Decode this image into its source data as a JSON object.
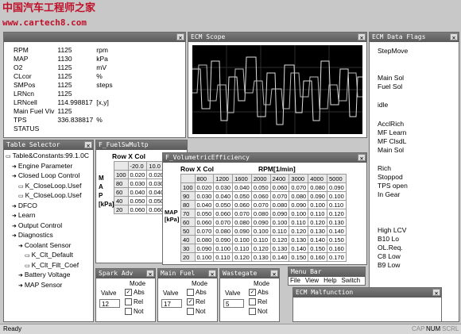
{
  "watermark": {
    "cn": "中国汽车工程师之家",
    "url": "www.cartech8.com"
  },
  "params": {
    "rows": [
      {
        "name": "RPM",
        "value": "1125",
        "unit": "rpm"
      },
      {
        "name": "MAP",
        "value": "1130",
        "unit": "kPa"
      },
      {
        "name": "O2",
        "value": "1125",
        "unit": "mV"
      },
      {
        "name": "CLcor",
        "value": "1125",
        "unit": "%"
      },
      {
        "name": "SMPos",
        "value": "1125",
        "unit": "steps"
      },
      {
        "name": "LRNcn",
        "value": "1125",
        "unit": ""
      },
      {
        "name": "LRNcell",
        "value": "114.998817",
        "unit": "[x,y]"
      },
      {
        "name": "Main Fuel Viv",
        "value": "1125",
        "unit": ""
      },
      {
        "name": "TPS",
        "value": "336.838817",
        "unit": "%"
      },
      {
        "name": "STATUS",
        "value": "",
        "unit": ""
      }
    ]
  },
  "scope": {
    "title": "ECM Scope"
  },
  "flags": {
    "title": "ECM Data Flags",
    "items": [
      "StepMove",
      "Main Sol",
      "Fuel Sol",
      "idle",
      "AcclRich",
      "MF Learn",
      "MF ClsdL",
      "Main Sol",
      "Rich",
      "Stoppod",
      "TPS open",
      "In Gear",
      "High LCV",
      "B10 Lo",
      "OL.Req.",
      "C8 Low",
      "B9 Low"
    ]
  },
  "tree": {
    "title": "Table Selector",
    "items": [
      {
        "label": "Table&Constants:99.1.0C",
        "level": 0,
        "icon": "folder"
      },
      {
        "label": "Engine Parameter",
        "level": 1,
        "icon": "arrow"
      },
      {
        "label": "Closed Loop Control",
        "level": 1,
        "icon": "arrow"
      },
      {
        "label": "K_CloseLoop.Usef",
        "level": 2,
        "icon": "folder"
      },
      {
        "label": "K_CloseLoop.Usef",
        "level": 2,
        "icon": "folder"
      },
      {
        "label": "DFCO",
        "level": 1,
        "icon": "arrow"
      },
      {
        "label": "Learn",
        "level": 1,
        "icon": "arrow"
      },
      {
        "label": "Output Control",
        "level": 1,
        "icon": "arrow"
      },
      {
        "label": "Diagnostics",
        "level": 1,
        "icon": "arrow"
      },
      {
        "label": "Coolant Sensor",
        "level": 2,
        "icon": "arrow"
      },
      {
        "label": "K_Clt_Default",
        "level": 3,
        "icon": "folder"
      },
      {
        "label": "K_Clt_Filt_Coef",
        "level": 3,
        "icon": "folder"
      },
      {
        "label": "Battery Voltage",
        "level": 2,
        "icon": "arrow"
      },
      {
        "label": "MAP Sensor",
        "level": 2,
        "icon": "arrow"
      }
    ]
  },
  "fuel_mult": {
    "title": "F_FuelSwMultp",
    "header": "Row X Col",
    "axis_label": [
      "M",
      "A",
      "P",
      "[kPa]"
    ],
    "col_head": [
      "-20.0",
      "10.0"
    ],
    "rows": [
      [
        "100",
        "0.020",
        "0.020"
      ],
      [
        "80",
        "0.030",
        "0.030"
      ],
      [
        "60",
        "0.040",
        "0.040"
      ],
      [
        "40",
        "0.050",
        "0.050"
      ],
      [
        "20",
        "0.060",
        "0.060"
      ]
    ]
  },
  "ve": {
    "title": "F_VolumetricEfficiency",
    "header": "Row X Col",
    "col_title": "RPM[1/min]",
    "row_title": "MAP [kPa]",
    "cols": [
      "800",
      "1200",
      "1600",
      "2000",
      "2400",
      "3000",
      "4000",
      "5000"
    ],
    "rows": [
      [
        "100",
        "0.020",
        "0.030",
        "0.040",
        "0.050",
        "0.060",
        "0.070",
        "0.080",
        "0.090"
      ],
      [
        "90",
        "0.030",
        "0.040",
        "0.050",
        "0.060",
        "0.070",
        "0.080",
        "0.090",
        "0.100"
      ],
      [
        "80",
        "0.040",
        "0.050",
        "0.060",
        "0.070",
        "0.080",
        "0.090",
        "0.100",
        "0.110"
      ],
      [
        "70",
        "0.050",
        "0.060",
        "0.070",
        "0.080",
        "0.090",
        "0.100",
        "0.110",
        "0.120"
      ],
      [
        "60",
        "0.060",
        "0.070",
        "0.080",
        "0.090",
        "0.100",
        "0.110",
        "0.120",
        "0.130"
      ],
      [
        "50",
        "0.070",
        "0.080",
        "0.090",
        "0.100",
        "0.110",
        "0.120",
        "0.130",
        "0.140"
      ],
      [
        "40",
        "0.080",
        "0.090",
        "0.100",
        "0.110",
        "0.120",
        "0.130",
        "0.140",
        "0.150"
      ],
      [
        "30",
        "0.090",
        "0.100",
        "0.110",
        "0.120",
        "0.130",
        "0.140",
        "0.150",
        "0.160"
      ],
      [
        "20",
        "0.100",
        "0.110",
        "0.120",
        "0.130",
        "0.140",
        "0.150",
        "0.160",
        "0.170"
      ]
    ]
  },
  "spark": {
    "title": "Spark Adv",
    "valve_label": "Valve",
    "value": "12",
    "mode_label": "Mode",
    "modes": [
      "Abs",
      "Rel",
      "Not"
    ],
    "checked": [
      true,
      false,
      false
    ]
  },
  "mainfuel": {
    "title": "Main Fuel",
    "valve_label": "Valve",
    "value": "17",
    "mode_label": "Mode",
    "modes": [
      "Abs",
      "Rel",
      "Not"
    ],
    "checked": [
      false,
      true,
      false
    ]
  },
  "wastegate": {
    "title": "Wastegate",
    "valve_label": "Valve",
    "value": "5",
    "mode_label": "Mode",
    "modes": [
      "Abs",
      "Rel",
      "Not"
    ],
    "checked": [
      true,
      false,
      false
    ]
  },
  "menubar": {
    "title": "Menu Bar",
    "items": [
      "File",
      "View",
      "Help",
      "Switch"
    ]
  },
  "malfunction": {
    "title": "ECM Malfunction"
  },
  "status": {
    "text": "Ready",
    "caps": "CAP",
    "num": "NUM",
    "scrl": "SCRL"
  }
}
